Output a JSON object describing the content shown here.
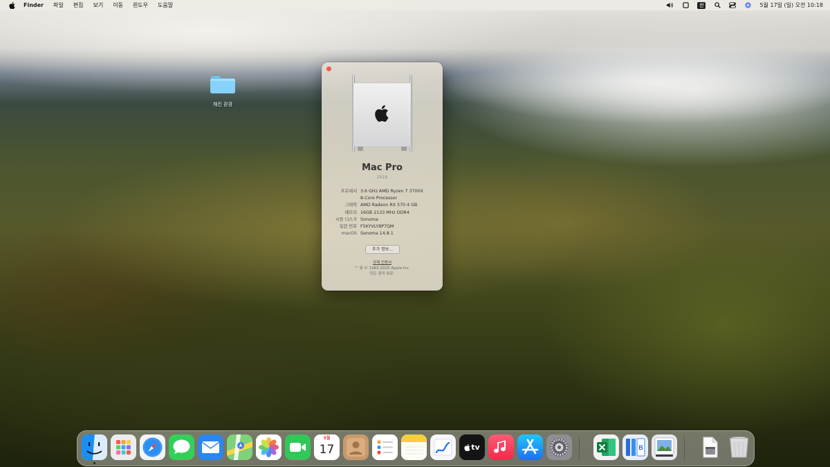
{
  "menubar": {
    "app_name": "Finder",
    "menus": [
      "파일",
      "편집",
      "보기",
      "이동",
      "윈도우",
      "도움말"
    ],
    "input_method": "한",
    "clock": "5월 17일 (일) 오전 10:18"
  },
  "desktop": {
    "folder_label": "해킨 환경"
  },
  "about_window": {
    "model": "Mac Pro",
    "year": "2019",
    "specs": [
      {
        "label": "프로세서",
        "value": "3.6 GHz AMD Ryzen 7 3700X"
      },
      {
        "label": "",
        "value": "8-Core Processor"
      },
      {
        "label": "그래픽",
        "value": "AMD Radeon RX 570 4 GB"
      },
      {
        "label": "메모리",
        "value": "16GB 2133 MHz DDR4"
      },
      {
        "label": "시동 디스크",
        "value": "Sonoma"
      },
      {
        "label": "일련 번호",
        "value": "F5KYVLY8P7QM"
      },
      {
        "label": "macOS",
        "value": "Sonoma 14.8.1"
      }
    ],
    "more_info_button": "추가 정보...",
    "regulatory_link": "규제 인증서",
    "copyright_line1": "™ 및 © 1983-2025 Apple Inc.",
    "copyright_line2": "모든 권리 보유.",
    "close_color": "#ee5a52"
  },
  "dock": {
    "apps": [
      {
        "name": "finder-icon",
        "running": true
      },
      {
        "name": "launchpad-icon",
        "running": false
      },
      {
        "name": "safari-icon",
        "running": false
      },
      {
        "name": "messages-icon",
        "running": false
      },
      {
        "name": "mail-icon",
        "running": false
      },
      {
        "name": "maps-icon",
        "running": false
      },
      {
        "name": "photos-icon",
        "running": false
      },
      {
        "name": "facetime-icon",
        "running": false
      },
      {
        "name": "calendar-icon",
        "running": false
      },
      {
        "name": "contacts-icon",
        "running": false
      },
      {
        "name": "reminders-icon",
        "running": false
      },
      {
        "name": "notes-icon",
        "running": false
      },
      {
        "name": "freeform-icon",
        "running": false
      },
      {
        "name": "apple-tv-icon",
        "running": false
      },
      {
        "name": "music-icon",
        "running": false
      },
      {
        "name": "app-store-icon",
        "running": false
      },
      {
        "name": "system-settings-icon",
        "running": false
      },
      {
        "name": "excel-icon",
        "running": false
      },
      {
        "name": "ui-browser-icon",
        "running": false
      },
      {
        "name": "preview-icon",
        "running": false
      },
      {
        "name": "documents-folder-icon",
        "running": false
      },
      {
        "name": "trash-icon",
        "running": false
      }
    ],
    "calendar_month": "5월",
    "calendar_day": "17",
    "tv_label": "tv"
  }
}
